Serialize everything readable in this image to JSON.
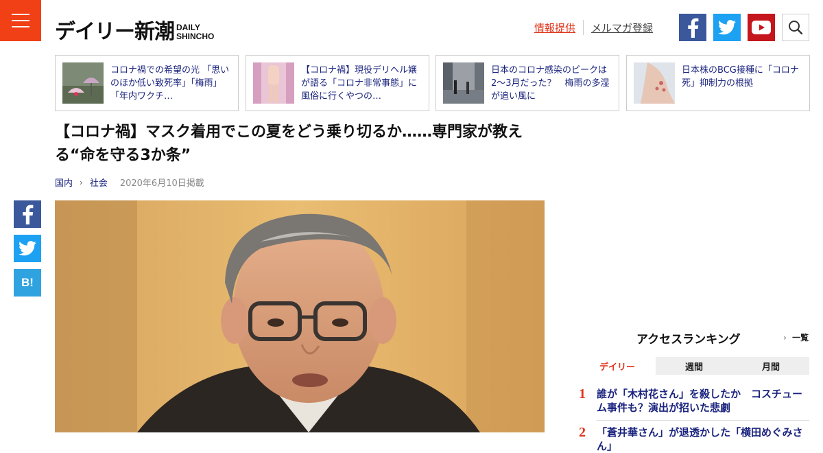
{
  "header": {
    "logo_jp": "デイリー新潮",
    "logo_en_1": "DAILY",
    "logo_en_2": "SHINCHO",
    "link_info": "情報提供",
    "link_mail": "メルマガ登録"
  },
  "related": [
    {
      "text": "コロナ禍での希望の光 「思いのほか低い致死率」「梅雨」「年内ワクチ…"
    },
    {
      "text": "【コロナ禍】現役デリヘル嬢が語る「コロナ非常事態」に風俗に行くやつの…"
    },
    {
      "text": "日本のコロナ感染のピークは2～3月だった？　梅雨の多湿が追い風に"
    },
    {
      "text": "日本株のBCG接種に「コロナ死」抑制力の根拠"
    }
  ],
  "article": {
    "title": "【コロナ禍】マスク着用でこの夏をどう乗り切るか……専門家が教える“命を守る3か条”",
    "crumb_1": "国内",
    "crumb_2": "社会",
    "date": "2020年6月10日掲載"
  },
  "share": {
    "hatena_label": "B!"
  },
  "ranking": {
    "title": "アクセスランキング",
    "more": "一覧",
    "tabs": [
      "デイリー",
      "週間",
      "月間"
    ],
    "items": [
      {
        "num": "1",
        "text": "誰が「木村花さん」を殺したか　コスチューム事件も？演出が招いた悲劇"
      },
      {
        "num": "2",
        "text": "「蒼井華さん」が退透かした「横田めぐみさん」"
      }
    ]
  },
  "colors": {
    "brand": "#f13f16",
    "facebook": "#3a589b",
    "twitter": "#1da1f2",
    "youtube": "#c4161c",
    "hatena": "#2fa3e0",
    "link": "#1a237e"
  }
}
